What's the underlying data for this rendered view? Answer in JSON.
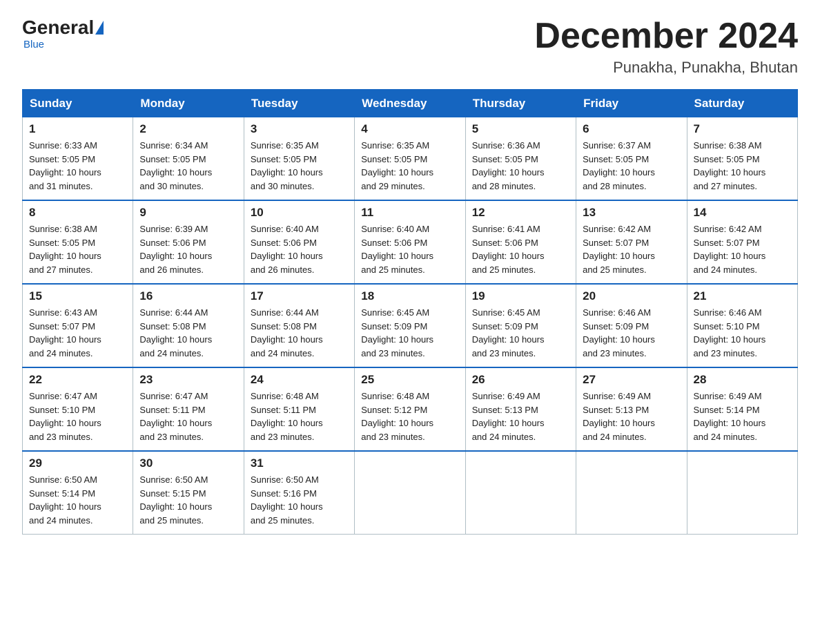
{
  "logo": {
    "general": "General",
    "blue": "Blue"
  },
  "header": {
    "month": "December 2024",
    "location": "Punakha, Punakha, Bhutan"
  },
  "weekdays": [
    "Sunday",
    "Monday",
    "Tuesday",
    "Wednesday",
    "Thursday",
    "Friday",
    "Saturday"
  ],
  "weeks": [
    [
      {
        "day": "1",
        "sunrise": "6:33 AM",
        "sunset": "5:05 PM",
        "daylight": "10 hours and 31 minutes."
      },
      {
        "day": "2",
        "sunrise": "6:34 AM",
        "sunset": "5:05 PM",
        "daylight": "10 hours and 30 minutes."
      },
      {
        "day": "3",
        "sunrise": "6:35 AM",
        "sunset": "5:05 PM",
        "daylight": "10 hours and 30 minutes."
      },
      {
        "day": "4",
        "sunrise": "6:35 AM",
        "sunset": "5:05 PM",
        "daylight": "10 hours and 29 minutes."
      },
      {
        "day": "5",
        "sunrise": "6:36 AM",
        "sunset": "5:05 PM",
        "daylight": "10 hours and 28 minutes."
      },
      {
        "day": "6",
        "sunrise": "6:37 AM",
        "sunset": "5:05 PM",
        "daylight": "10 hours and 28 minutes."
      },
      {
        "day": "7",
        "sunrise": "6:38 AM",
        "sunset": "5:05 PM",
        "daylight": "10 hours and 27 minutes."
      }
    ],
    [
      {
        "day": "8",
        "sunrise": "6:38 AM",
        "sunset": "5:05 PM",
        "daylight": "10 hours and 27 minutes."
      },
      {
        "day": "9",
        "sunrise": "6:39 AM",
        "sunset": "5:06 PM",
        "daylight": "10 hours and 26 minutes."
      },
      {
        "day": "10",
        "sunrise": "6:40 AM",
        "sunset": "5:06 PM",
        "daylight": "10 hours and 26 minutes."
      },
      {
        "day": "11",
        "sunrise": "6:40 AM",
        "sunset": "5:06 PM",
        "daylight": "10 hours and 25 minutes."
      },
      {
        "day": "12",
        "sunrise": "6:41 AM",
        "sunset": "5:06 PM",
        "daylight": "10 hours and 25 minutes."
      },
      {
        "day": "13",
        "sunrise": "6:42 AM",
        "sunset": "5:07 PM",
        "daylight": "10 hours and 25 minutes."
      },
      {
        "day": "14",
        "sunrise": "6:42 AM",
        "sunset": "5:07 PM",
        "daylight": "10 hours and 24 minutes."
      }
    ],
    [
      {
        "day": "15",
        "sunrise": "6:43 AM",
        "sunset": "5:07 PM",
        "daylight": "10 hours and 24 minutes."
      },
      {
        "day": "16",
        "sunrise": "6:44 AM",
        "sunset": "5:08 PM",
        "daylight": "10 hours and 24 minutes."
      },
      {
        "day": "17",
        "sunrise": "6:44 AM",
        "sunset": "5:08 PM",
        "daylight": "10 hours and 24 minutes."
      },
      {
        "day": "18",
        "sunrise": "6:45 AM",
        "sunset": "5:09 PM",
        "daylight": "10 hours and 23 minutes."
      },
      {
        "day": "19",
        "sunrise": "6:45 AM",
        "sunset": "5:09 PM",
        "daylight": "10 hours and 23 minutes."
      },
      {
        "day": "20",
        "sunrise": "6:46 AM",
        "sunset": "5:09 PM",
        "daylight": "10 hours and 23 minutes."
      },
      {
        "day": "21",
        "sunrise": "6:46 AM",
        "sunset": "5:10 PM",
        "daylight": "10 hours and 23 minutes."
      }
    ],
    [
      {
        "day": "22",
        "sunrise": "6:47 AM",
        "sunset": "5:10 PM",
        "daylight": "10 hours and 23 minutes."
      },
      {
        "day": "23",
        "sunrise": "6:47 AM",
        "sunset": "5:11 PM",
        "daylight": "10 hours and 23 minutes."
      },
      {
        "day": "24",
        "sunrise": "6:48 AM",
        "sunset": "5:11 PM",
        "daylight": "10 hours and 23 minutes."
      },
      {
        "day": "25",
        "sunrise": "6:48 AM",
        "sunset": "5:12 PM",
        "daylight": "10 hours and 23 minutes."
      },
      {
        "day": "26",
        "sunrise": "6:49 AM",
        "sunset": "5:13 PM",
        "daylight": "10 hours and 24 minutes."
      },
      {
        "day": "27",
        "sunrise": "6:49 AM",
        "sunset": "5:13 PM",
        "daylight": "10 hours and 24 minutes."
      },
      {
        "day": "28",
        "sunrise": "6:49 AM",
        "sunset": "5:14 PM",
        "daylight": "10 hours and 24 minutes."
      }
    ],
    [
      {
        "day": "29",
        "sunrise": "6:50 AM",
        "sunset": "5:14 PM",
        "daylight": "10 hours and 24 minutes."
      },
      {
        "day": "30",
        "sunrise": "6:50 AM",
        "sunset": "5:15 PM",
        "daylight": "10 hours and 25 minutes."
      },
      {
        "day": "31",
        "sunrise": "6:50 AM",
        "sunset": "5:16 PM",
        "daylight": "10 hours and 25 minutes."
      },
      null,
      null,
      null,
      null
    ]
  ]
}
